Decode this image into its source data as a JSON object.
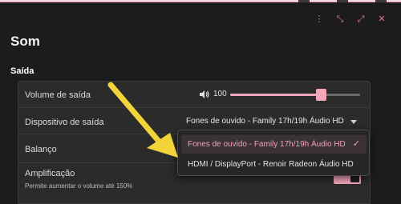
{
  "window": {
    "controls": [
      {
        "name": "menu-icon",
        "glyph": "⋮"
      },
      {
        "name": "minimize-icon",
        "glyph": "⤡"
      },
      {
        "name": "maximize-icon",
        "glyph": "⤢"
      },
      {
        "name": "close-icon",
        "glyph": "✕"
      }
    ]
  },
  "page": {
    "title": "Som",
    "section_title": "Saída"
  },
  "output": {
    "volume_label": "Volume de saída",
    "volume_value": "100",
    "volume_level": 0.7,
    "device_label": "Dispositivo de saída",
    "device_value": "Fones de ouvido - Family 17h/19h Áudio HD",
    "balance_label": "Balanço",
    "amplification_label": "Amplificação",
    "amplification_hint": "Permite aumentar o volume até 150%"
  },
  "dropdown": {
    "options": [
      {
        "label": "Fones de ouvido - Family 17h/19h Áudio HD",
        "selected": true
      },
      {
        "label": "HDMI / DisplayPort - Renoir Radeon Áudio HD",
        "selected": false
      }
    ],
    "check_glyph": "✓"
  },
  "colors": {
    "accent": "#f4a7b9",
    "annotation_arrow": "#f2d43a",
    "background": "#1c1c1c",
    "panel": "#2b2b2b"
  }
}
